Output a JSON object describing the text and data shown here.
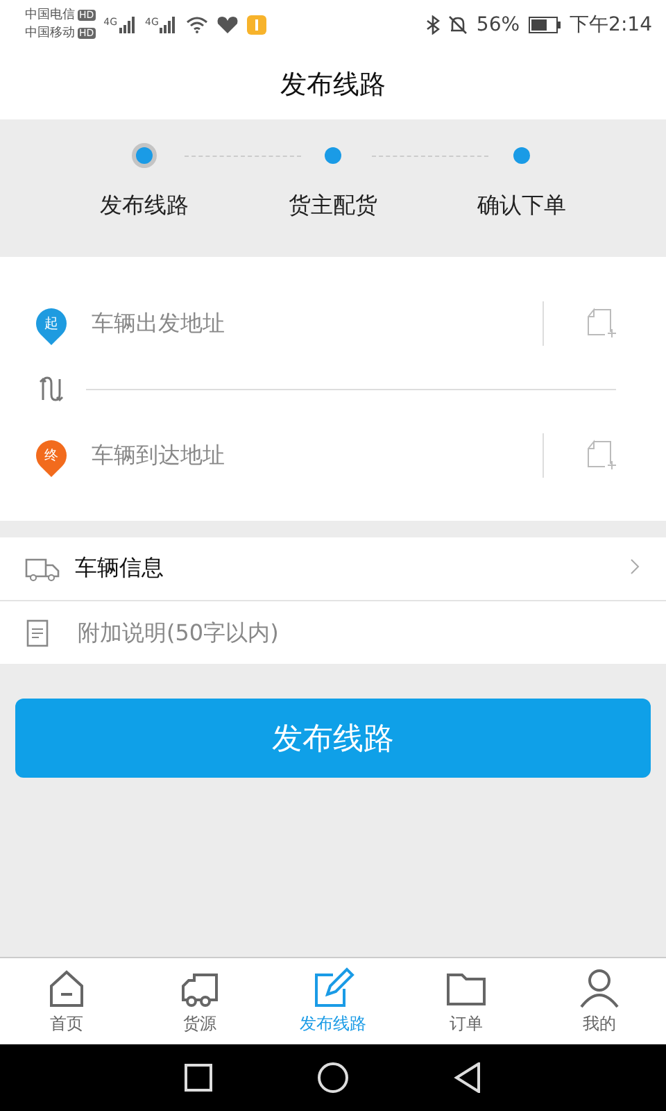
{
  "status_bar": {
    "carriers": [
      {
        "name": "中国电信",
        "badge": "HD"
      },
      {
        "name": "中国移动",
        "badge": "HD"
      }
    ],
    "signals": [
      "4G",
      "4G"
    ],
    "battery": "56%",
    "time": "下午2:14"
  },
  "title": "发布线路",
  "steps": [
    {
      "label": "发布线路",
      "selected": true
    },
    {
      "label": "货主配货",
      "selected": false
    },
    {
      "label": "确认下单",
      "selected": false
    }
  ],
  "addresses": [
    {
      "pin": "起",
      "placeholder": "车辆出发地址",
      "color": "#1e9be0"
    },
    {
      "pin": "终",
      "placeholder": "车辆到达地址",
      "color": "#f26b1d"
    }
  ],
  "vehicle_info": {
    "label": "车辆信息"
  },
  "note": {
    "placeholder": "附加说明(50字以内)"
  },
  "submit": "发布线路",
  "tabs": [
    {
      "label": "首页",
      "kind": "home",
      "selected": false
    },
    {
      "label": "货源",
      "kind": "truck",
      "selected": false
    },
    {
      "label": "发布线路",
      "kind": "edit",
      "selected": true
    },
    {
      "label": "订单",
      "kind": "folder",
      "selected": false
    },
    {
      "label": "我的",
      "kind": "user",
      "selected": false
    }
  ]
}
